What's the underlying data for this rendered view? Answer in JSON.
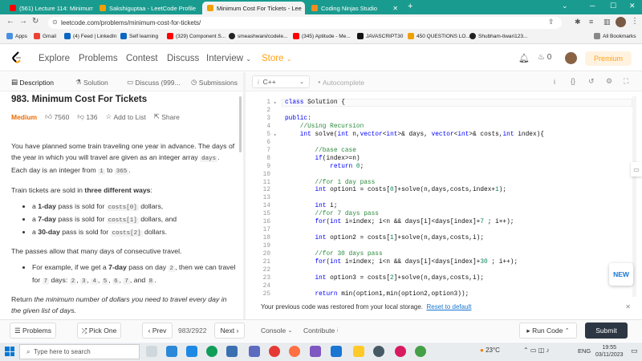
{
  "browser": {
    "tabs": [
      {
        "title": "(561) Lecture 114: Minimum Co",
        "color": "#ff0000",
        "active": false
      },
      {
        "title": "Sakshiguptaa - LeetCode Profile",
        "color": "#f0a000",
        "active": false
      },
      {
        "title": "Minimum Cost For Tickets - Lee",
        "color": "#f0a000",
        "active": true
      },
      {
        "title": "Coding Ninjas Studio",
        "color": "#f68b1e",
        "active": false
      }
    ],
    "url": "leetcode.com/problems/minimum-cost-for-tickets/",
    "bookmarks": [
      {
        "label": "Apps",
        "color": "#4a90e2"
      },
      {
        "label": "Gmail",
        "color": "#ea4335"
      },
      {
        "label": "(4) Feed | LinkedIn",
        "color": "#0a66c2"
      },
      {
        "label": "Self learning",
        "color": "#0a66c2"
      },
      {
        "label": "(329) Component S...",
        "color": "#ff0000"
      },
      {
        "label": "smeashwani/codele...",
        "color": "#222"
      },
      {
        "label": "(345) Aptitude - Me...",
        "color": "#ff0000"
      },
      {
        "label": "JAVASCRIPT30",
        "color": "#111"
      },
      {
        "label": "450 QUESTIONS LO...",
        "color": "#f0a000"
      },
      {
        "label": "Shubham-tiwari123...",
        "color": "#222"
      }
    ],
    "all_bookmarks": "All Bookmarks"
  },
  "nav": {
    "links": [
      "Explore",
      "Problems",
      "Contest",
      "Discuss",
      "Interview",
      "Store"
    ],
    "streak": "0",
    "premium": "Premium"
  },
  "left_tabs": [
    "Description",
    "Solution",
    "Discuss (999...",
    "Submissions"
  ],
  "problem": {
    "title": "983. Minimum Cost For Tickets",
    "difficulty": "Medium",
    "likes": "7560",
    "dislikes": "136",
    "add_to_list": "Add to List",
    "share": "Share",
    "p1a": "You have planned some train traveling one year in advance. The days of the year in which you will travel are given as an integer array",
    "p1_code": "days",
    "p1b": ". Each day is an integer from",
    "p1_c1": "1",
    "p1_to": "to",
    "p1_c2": "365",
    "p1_end": ".",
    "p2a": "Train tickets are sold in",
    "p2b": "three different ways",
    "p2c": ":",
    "bullets": [
      {
        "pre": "a",
        "bold": "1-day",
        "mid": "pass is sold for",
        "code": "costs[0]",
        "post": "dollars,"
      },
      {
        "pre": "a",
        "bold": "7-day",
        "mid": "pass is sold for",
        "code": "costs[1]",
        "post": "dollars, and"
      },
      {
        "pre": "a",
        "bold": "30-day",
        "mid": "pass is sold for",
        "code": "costs[2]",
        "post": "dollars."
      }
    ],
    "p3": "The passes allow that many days of consecutive travel.",
    "ex_a": "For example, if we get a",
    "ex_b": "7-day",
    "ex_c": "pass on day",
    "ex_d": "2",
    "ex_e": ", then we can travel for",
    "ex_f": "7",
    "ex_g": "days:",
    "ex_days": [
      "2",
      "3",
      "4",
      "5",
      "6",
      "7"
    ],
    "ex_and": "and",
    "ex_last": "8",
    "ret_a": "Return",
    "ret_b": "the minimum number of dollars you need to travel every day in the given list of days."
  },
  "editor": {
    "language": "C++",
    "autocomplete": "Autocomplete",
    "lines": [
      "class Solution {",
      "",
      "public:",
      "    //Using Recursion",
      "    int solve(int n,vector<int>& days, vector<int>& costs,int index){",
      "",
      "        //base case",
      "        if(index>=n)",
      "            return 0;",
      "",
      "        //for 1 day pass",
      "        int option1 = costs[0]+solve(n,days,costs,index+1);",
      "",
      "        int i;",
      "        //for 7 days pass",
      "        for(int i=index; i<n && days[i]<days[index]+7 ; i++);",
      "",
      "        int option2 = costs[1]+solve(n,days,costs,i);",
      "",
      "        //for 30 days pass",
      "        for(int i=index; i<n && days[i]<days[index]+30 ; i++);",
      "",
      "        int option3 = costs[2]+solve(n,days,costs,i);",
      "",
      "        return min(option1,min(option2,option3));"
    ],
    "restore_msg": "Your previous code was restored from your local storage.",
    "reset": "Reset to default",
    "new_badge": "NEW"
  },
  "bottom": {
    "problems": "Problems",
    "pick_one": "Pick One",
    "prev": "Prev",
    "counter": "983/2922",
    "next": "Next",
    "console": "Console",
    "contribute": "Contribute",
    "run_code": "Run Code",
    "submit": "Submit"
  },
  "taskbar": {
    "search": "Type here to search",
    "temp": "23°C",
    "lang": "ENG",
    "time": "19:55",
    "date": "03/11/2023"
  },
  "colors": {
    "accent": "#ffa116",
    "medium": "#ef6c00",
    "submit": "#2d3743",
    "teal": "#1a9b8f"
  }
}
